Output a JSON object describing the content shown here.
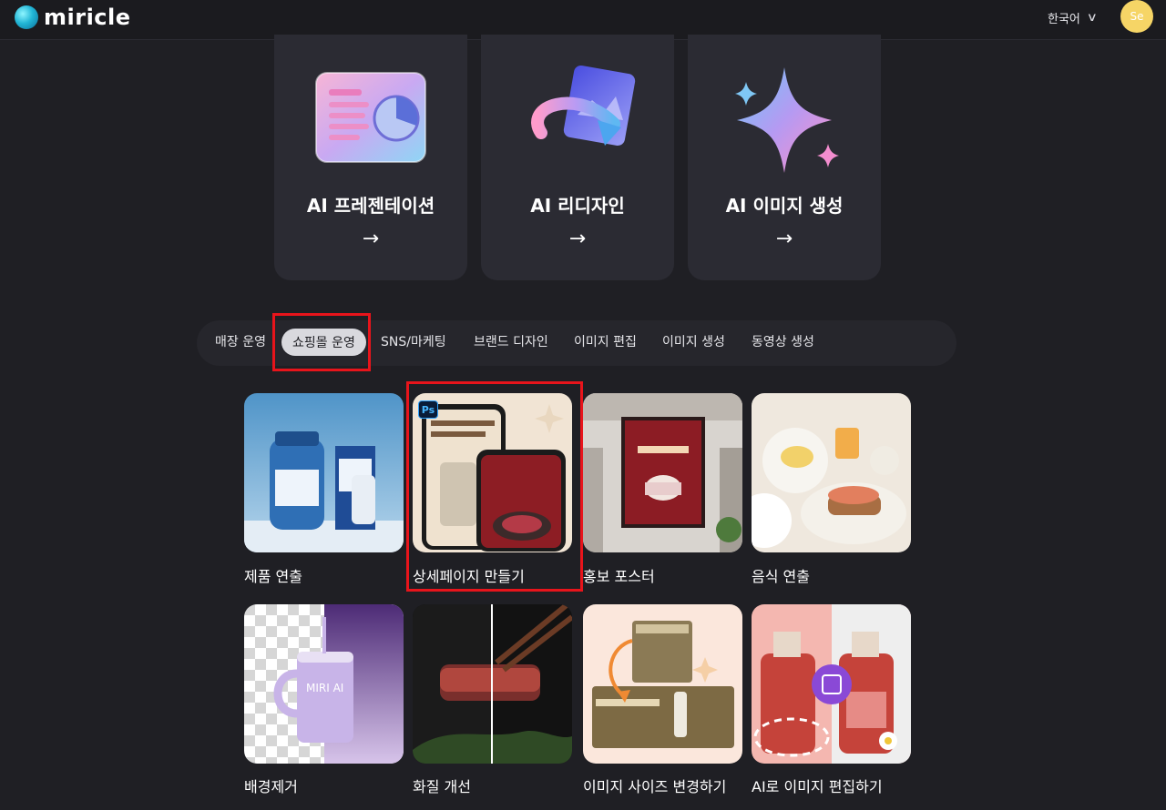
{
  "brand": {
    "name": "miricle"
  },
  "header": {
    "language": "한국어",
    "avatar_initials": "Se"
  },
  "features": [
    {
      "title": "AI 프레젠테이션",
      "arrow": "→"
    },
    {
      "title": "AI 리디자인",
      "arrow": "→"
    },
    {
      "title": "AI 이미지 생성",
      "arrow": "→"
    }
  ],
  "tabs": [
    {
      "label": "매장 운영"
    },
    {
      "label": "쇼핑몰 운영",
      "active": true
    },
    {
      "label": "SNS/마케팅"
    },
    {
      "label": "브랜드 디자인"
    },
    {
      "label": "이미지 편집"
    },
    {
      "label": "이미지 생성"
    },
    {
      "label": "동영상 생성"
    }
  ],
  "templates": [
    {
      "label": "제품 연출"
    },
    {
      "label": "상세페이지 만들기",
      "badge": "Ps"
    },
    {
      "label": "홍보 포스터"
    },
    {
      "label": "음식 연출"
    },
    {
      "label": "배경제거"
    },
    {
      "label": "화질 개선"
    },
    {
      "label": "이미지 사이즈 변경하기"
    },
    {
      "label": "AI로 이미지 편집하기"
    }
  ],
  "colors": {
    "background": "#1f1f24",
    "card": "#2b2b33",
    "highlight": "#e8141b",
    "avatar": "#f6d566"
  }
}
